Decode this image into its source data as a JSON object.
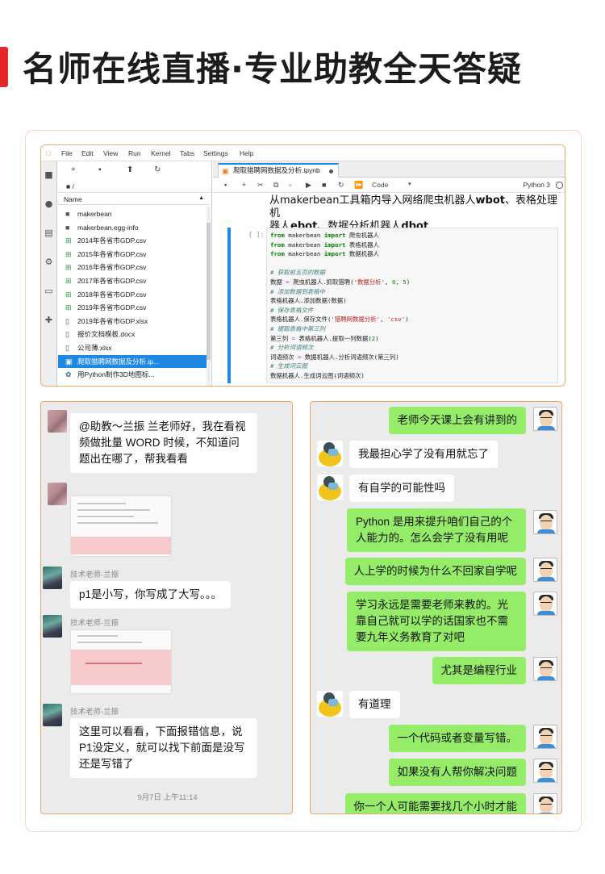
{
  "headline": "名师在线直播·专业助教全天答疑",
  "jupyter": {
    "menu": [
      "File",
      "Edit",
      "View",
      "Run",
      "Kernel",
      "Tabs",
      "Settings",
      "Help"
    ],
    "path": "/",
    "col_name": "Name",
    "files": [
      {
        "icon": "folder",
        "name": "makerbean"
      },
      {
        "icon": "folder",
        "name": "makerbean.egg-info"
      },
      {
        "icon": "csv",
        "name": "2014年各省市GDP.csv"
      },
      {
        "icon": "csv",
        "name": "2015年各省市GDP.csv"
      },
      {
        "icon": "csv",
        "name": "2016年各省市GDP.csv"
      },
      {
        "icon": "csv",
        "name": "2017年各省市GDP.csv"
      },
      {
        "icon": "csv",
        "name": "2018年各省市GDP.csv"
      },
      {
        "icon": "csv",
        "name": "2019年各省市GDP.csv"
      },
      {
        "icon": "file",
        "name": "2019年各省市GDP.xlsx"
      },
      {
        "icon": "file",
        "name": "报价文档模板.docx"
      },
      {
        "icon": "file",
        "name": "公司薄.xlsx"
      },
      {
        "icon": "notebook",
        "name": "爬取猎聘网数据及分析.ip..."
      },
      {
        "icon": "python",
        "name": "用Python制作3D地图标..."
      }
    ],
    "tab_title": "爬取猎聘网数据及分析.ipynb",
    "celltype": "Code",
    "kernel": "Python 3",
    "md_line1": "从makerbean工具箱内导入网络爬虫机器人wbot、表格处理机",
    "md_line2": "器人ebot、数据分析机器人dbot",
    "prompt": "[ ]:"
  },
  "left_chat": {
    "msg1": "@助教～兰振  兰老师好，我在看视频做批量 WORD 时候，不知道问题出在哪了，帮我看看",
    "name1": "技术老师-兰振",
    "msg2": "p1是小写，你写成了大写。。。",
    "name2": "技术老师-兰振",
    "name3": "技术老师-兰振",
    "msg3": "这里可以看看，下面报错信息，说P1没定义，就可以找下前面是没写还是写错了",
    "time": "9月7日 上午11:14"
  },
  "right_chat": {
    "m1": "老师今天课上会有讲到的",
    "m2": "我最担心学了没有用就忘了",
    "m3": "有自学的可能性吗",
    "m4": "Python 是用来提升咱们自己的个人能力的。怎么会学了没有用呢",
    "m5": "人上学的时候为什么不回家自学呢",
    "m6": "学习永远是需要老师来教的。光靠自己就可以学的话国家也不需要九年义务教育了对吧",
    "m7": "尤其是编程行业",
    "m8": "有道理",
    "m9": "一个代码或者变量写错。",
    "m10": "如果没有人帮你解决问题",
    "m11": "你一个人可能需要找几个小时才能"
  }
}
